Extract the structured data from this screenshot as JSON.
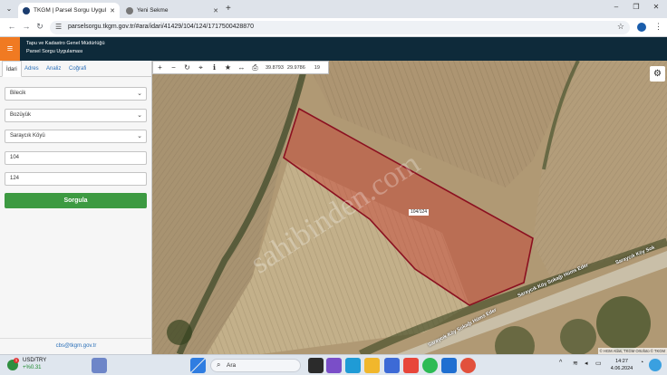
{
  "browser": {
    "tabs": [
      {
        "title": "TKGM | Parsel Sorgu Uygulaması",
        "active": true
      },
      {
        "title": "Yeni Sekme",
        "active": false
      }
    ],
    "url": "parselsorgu.tkgm.gov.tr/#ara/idari/41429/104/124/1717500428870",
    "new_tab_icon": "+",
    "min_icon": "–",
    "max_icon": "❐",
    "close_icon": "✕"
  },
  "app": {
    "title_line1": "Tapu ve Kadastro Genel Müdürlüğü",
    "title_line2": "Parsel Sorgu Uygulaması",
    "accent": "#f07a22"
  },
  "panel": {
    "tabs": [
      "İdari",
      "Adres",
      "Analiz",
      "Coğrafi"
    ],
    "province": "Bilecik",
    "district": "Bozüyük",
    "neighborhood": "Saraycık Köyü",
    "block": "104",
    "parcel": "124",
    "query_button": "Sorgula",
    "footer_email": "cbs@tkgm.gov.tr"
  },
  "map": {
    "coord_lat": "39.8793",
    "coord_lon": "29.9786",
    "zoom": "19",
    "parcel_label": "104/124",
    "road_label_1": "Saraycık Köy Sokağı Hüms Eder",
    "road_label_2": "Saraycık Köy Sokağı Hüms Eder",
    "road_label_3": "Saraycık Köy Sok",
    "watermark": "sahibinden.com",
    "attribution": "© HGM Atlas, TKGM Ortofoto © TKGM"
  },
  "taskbar": {
    "ticker_name": "USD/TRY",
    "ticker_value": "+%0.31",
    "ticker_badge": "1",
    "search_placeholder": "Ara",
    "time": "14:27",
    "date": "4.06.2024"
  }
}
